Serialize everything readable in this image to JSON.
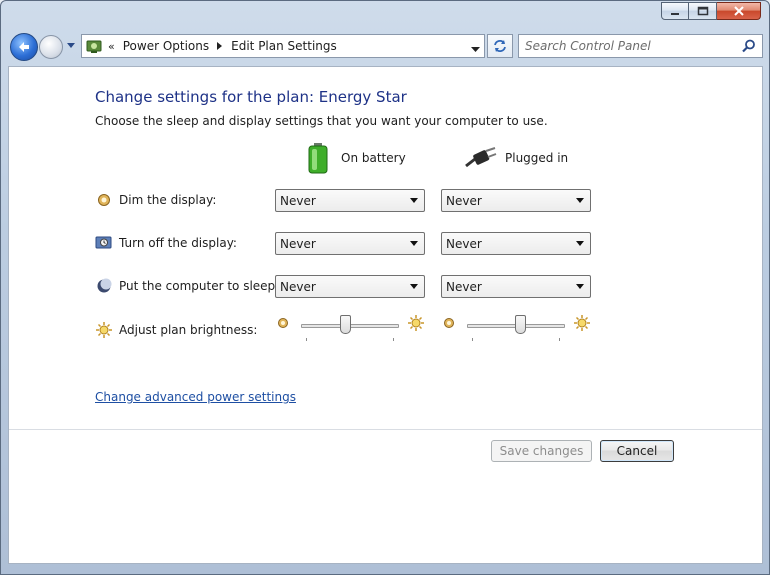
{
  "window": {
    "buttons": [
      "minimize",
      "maximize",
      "close"
    ]
  },
  "nav": {
    "breadcrumbs": [
      "Power Options",
      "Edit Plan Settings"
    ],
    "overflow_glyph": "«",
    "search_placeholder": "Search Control Panel"
  },
  "main": {
    "title": "Change settings for the plan: Energy Star",
    "subtitle": "Choose the sleep and display settings that you want your computer to use.",
    "columns": {
      "battery": "On battery",
      "plugged": "Plugged in"
    },
    "rows": {
      "dim": {
        "label": "Dim the display:",
        "battery": "Never",
        "plugged": "Never"
      },
      "off": {
        "label": "Turn off the display:",
        "battery": "Never",
        "plugged": "Never"
      },
      "sleep": {
        "label": "Put the computer to sleep:",
        "battery": "Never",
        "plugged": "Never"
      },
      "brightness": {
        "label": "Adjust plan brightness:",
        "battery_level": 0.45,
        "plugged_level": 0.55
      }
    },
    "advanced_link": "Change advanced power settings",
    "save_label": "Save changes",
    "cancel_label": "Cancel"
  },
  "colors": {
    "title_blue": "#1e3287",
    "link_blue": "#1e4fa3"
  }
}
